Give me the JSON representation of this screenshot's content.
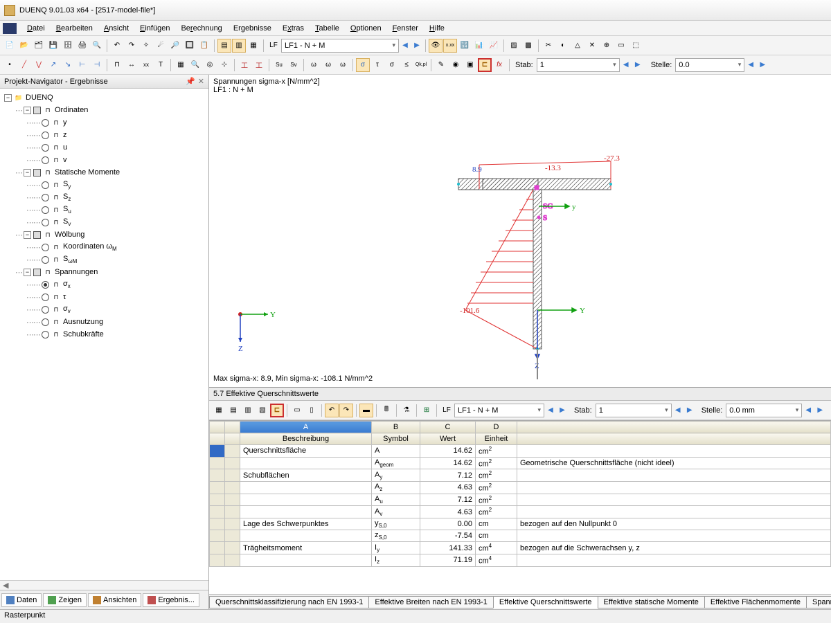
{
  "window": {
    "title": "DUENQ 9.01.03 x64 - [2517-model-file*]"
  },
  "menu": [
    "Datei",
    "Bearbeiten",
    "Ansicht",
    "Einfügen",
    "Berechnung",
    "Ergebnisse",
    "Extras",
    "Tabelle",
    "Optionen",
    "Fenster",
    "Hilfe"
  ],
  "toolbar1": {
    "loadcase": "LF1 - N + M"
  },
  "toolbar2": {
    "stab_label": "Stab:",
    "stab_value": "1",
    "stelle_label": "Stelle:",
    "stelle_value": "0.0"
  },
  "navigator": {
    "title": "Projekt-Navigator - Ergebnisse",
    "root": "DUENQ",
    "groups": [
      {
        "label": "Ordinaten",
        "items": [
          "y",
          "z",
          "u",
          "v"
        ]
      },
      {
        "label": "Statische Momente",
        "items": [
          "Sy",
          "Sz",
          "Su",
          "Sv"
        ]
      },
      {
        "label": "Wölbung",
        "items": [
          "Koordinaten ωM",
          "SωM"
        ]
      },
      {
        "label": "Spannungen",
        "items": [
          "σx",
          "τ",
          "σv",
          "Ausnutzung",
          "Schubkräfte"
        ],
        "selected": 0
      }
    ],
    "tabs": [
      "Daten",
      "Zeigen",
      "Ansichten",
      "Ergebnis..."
    ]
  },
  "viewport": {
    "title": "Spannungen sigma-x [N/mm^2]",
    "subtitle": "LF1 : N + M",
    "labels": {
      "v1": "8.9",
      "v2": "-13.3",
      "v3": "-27.3",
      "v4": "-101.6",
      "y": "Y",
      "z": "Z",
      "sg": "SG",
      "s": "S",
      "ys": "y"
    },
    "footer": "Max sigma-x: 8.9, Min sigma-x: -108.1 N/mm^2"
  },
  "lower": {
    "title": "5.7 Effektive Querschnittswerte",
    "loadcase": "LF1 - N + M",
    "stab_label": "Stab:",
    "stab_value": "1",
    "stelle_label": "Stelle:",
    "stelle_value": "0.0 mm",
    "cols_letter": [
      "A",
      "B",
      "C",
      "D"
    ],
    "cols_name": [
      "Beschreibung",
      "Symbol",
      "Wert",
      "Einheit"
    ],
    "rows": [
      {
        "desc": "Querschnittsfläche",
        "sym": "A",
        "val": "14.62",
        "unit": "cm2",
        "note": ""
      },
      {
        "desc": "",
        "sym": "Ageom",
        "val": "14.62",
        "unit": "cm2",
        "note": "Geometrische Querschnittsfläche (nicht ideel)"
      },
      {
        "desc": "Schubflächen",
        "sym": "Ay",
        "val": "7.12",
        "unit": "cm2",
        "note": ""
      },
      {
        "desc": "",
        "sym": "Az",
        "val": "4.63",
        "unit": "cm2",
        "note": ""
      },
      {
        "desc": "",
        "sym": "Au",
        "val": "7.12",
        "unit": "cm2",
        "note": ""
      },
      {
        "desc": "",
        "sym": "Av",
        "val": "4.63",
        "unit": "cm2",
        "note": ""
      },
      {
        "desc": "Lage des Schwerpunktes",
        "sym": "yS,0",
        "val": "0.00",
        "unit": "cm",
        "note": "bezogen auf den Nullpunkt 0"
      },
      {
        "desc": "",
        "sym": "zS,0",
        "val": "-7.54",
        "unit": "cm",
        "note": ""
      },
      {
        "desc": "Trägheitsmoment",
        "sym": "Iy",
        "val": "141.33",
        "unit": "cm4",
        "note": "bezogen auf die Schwerachsen y, z"
      },
      {
        "desc": "",
        "sym": "Iz",
        "val": "71.19",
        "unit": "cm4",
        "note": ""
      }
    ],
    "tabs": [
      "Querschnittsklassifizierung nach EN 1993-1",
      "Effektive Breiten nach EN 1993-1",
      "Effektive Querschnittswerte",
      "Effektive statische Momente",
      "Effektive Flächenmomente",
      "Spannungen auf dem"
    ],
    "active_tab": 2
  },
  "statusbar": "Rasterpunkt"
}
